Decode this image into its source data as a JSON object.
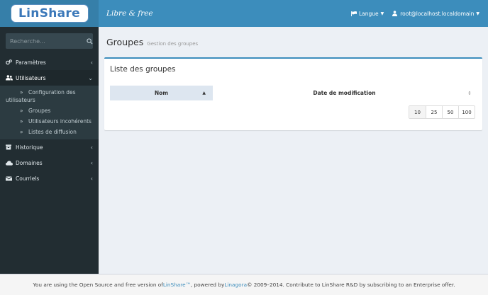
{
  "brand": {
    "logo_text": "LinShare",
    "tagline": "Libre & free"
  },
  "search": {
    "placeholder": "Recherche..."
  },
  "header": {
    "language_label": "Langue",
    "user_label": "root@localhost.localdomain"
  },
  "sidebar": {
    "items": [
      {
        "label": "Paramètres",
        "icon": "cogs-icon"
      },
      {
        "label": "Utilisateurs",
        "icon": "users-icon"
      },
      {
        "label": "Historique",
        "icon": "archive-icon"
      },
      {
        "label": "Domaines",
        "icon": "cloud-icon"
      },
      {
        "label": "Courriels",
        "icon": "envelope-icon"
      }
    ],
    "submenu": [
      {
        "label": "Configuration des utilisateurs"
      },
      {
        "label": "Groupes"
      },
      {
        "label": "Utilisateurs incohérents"
      },
      {
        "label": "Listes de diffusion"
      }
    ]
  },
  "page": {
    "title": "Groupes",
    "subtitle": "Gestion des groupes"
  },
  "box": {
    "title": "Liste des groupes"
  },
  "table": {
    "columns": [
      "Nom",
      "Date de modification"
    ]
  },
  "pager": {
    "sizes": [
      "10",
      "25",
      "50",
      "100"
    ]
  },
  "footer": {
    "prefix": "You are using the Open Source and free version of ",
    "linshare": "LinShare™",
    "middle": ", powered by ",
    "linagora": "Linagora",
    "suffix": " © 2009–2014. Contribute to LinShare R&D by subscribing to an Enterprise offer."
  },
  "colors": {
    "header": "#3c8dbc",
    "sidebar": "#222d32",
    "accent": "#3c8dbc"
  }
}
